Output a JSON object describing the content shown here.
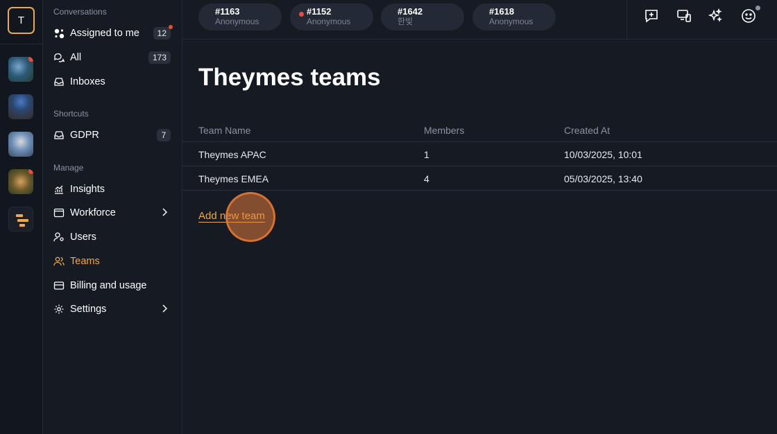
{
  "rail": {
    "workspace_initial": "T"
  },
  "sidebar": {
    "sections": {
      "conversations": "Conversations",
      "shortcuts": "Shortcuts",
      "manage": "Manage"
    },
    "items": {
      "assigned": {
        "label": "Assigned to me",
        "count": "12"
      },
      "all": {
        "label": "All",
        "count": "173"
      },
      "inboxes": {
        "label": "Inboxes"
      },
      "gdpr": {
        "label": "GDPR",
        "count": "7"
      },
      "insights": {
        "label": "Insights"
      },
      "workforce": {
        "label": "Workforce"
      },
      "users": {
        "label": "Users"
      },
      "teams": {
        "label": "Teams"
      },
      "billing": {
        "label": "Billing and usage"
      },
      "settings": {
        "label": "Settings"
      }
    }
  },
  "topbar": {
    "tabs": [
      {
        "number": "#1163",
        "name": "Anonymous"
      },
      {
        "number": "#1152",
        "name": "Anonymous"
      },
      {
        "number": "#1642",
        "name": "한빛"
      },
      {
        "number": "#1618",
        "name": "Anonymous"
      }
    ]
  },
  "main": {
    "title": "Theymes teams",
    "columns": [
      "Team Name",
      "Members",
      "Created At"
    ],
    "rows": [
      [
        "Theymes APAC",
        "1",
        "10/03/2025, 10:01"
      ],
      [
        "Theymes EMEA",
        "4",
        "05/03/2025, 13:40"
      ]
    ],
    "add_label": "Add new team"
  },
  "colors": {
    "accent": "#f0a94a",
    "background": "#151a23",
    "badge_dot": "#ef4a3c"
  }
}
